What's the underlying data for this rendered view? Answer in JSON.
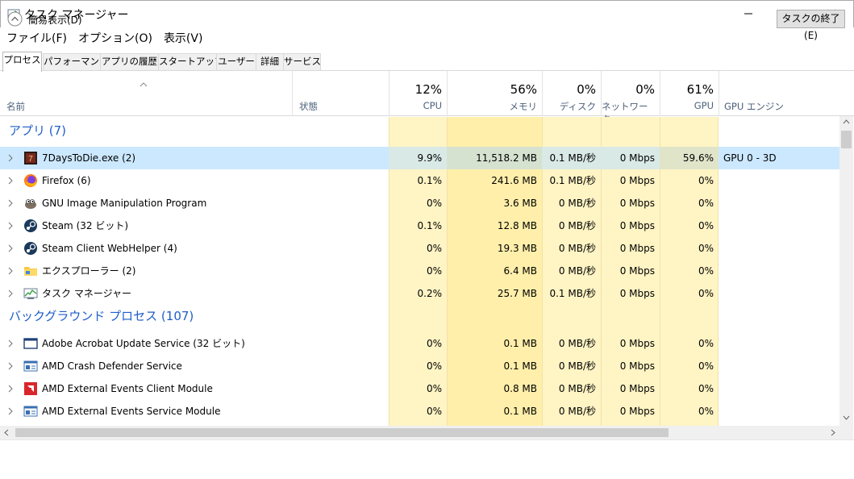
{
  "window": {
    "title": "タスク マネージャー",
    "icon": "task-manager-icon",
    "controls": [
      "minimize-icon",
      "maximize-icon",
      "close-icon"
    ]
  },
  "menu": [
    "ファイル(F)",
    "オプション(O)",
    "表示(V)"
  ],
  "tabs": [
    "プロセス",
    "パフォーマンス",
    "アプリの履歴",
    "スタートアップ",
    "ユーザー",
    "詳細",
    "サービス"
  ],
  "active_tab": "プロセス",
  "columns": {
    "name": "名前",
    "status": "状態",
    "cpu": {
      "percent": "12%",
      "label": "CPU"
    },
    "memory": {
      "percent": "56%",
      "label": "メモリ"
    },
    "disk": {
      "percent": "0%",
      "label": "ディスク"
    },
    "network": {
      "percent": "0%",
      "label": "ネットワーク"
    },
    "gpu": {
      "percent": "61%",
      "label": "GPU"
    },
    "gpu_engine": "GPU エンジン",
    "sort_indicator": "chevron-up-icon"
  },
  "groups": [
    {
      "title": "アプリ (7)",
      "items": [
        {
          "name": "7DaysToDie.exe (2)",
          "icon": "7days-icon",
          "cpu": "9.9%",
          "memory": "11,518.2 MB",
          "disk": "0.1 MB/秒",
          "network": "0 Mbps",
          "gpu": "59.6%",
          "gpu_engine": "GPU 0 - 3D",
          "selected": true
        },
        {
          "name": "Firefox (6)",
          "icon": "firefox-icon",
          "cpu": "0.1%",
          "memory": "241.6 MB",
          "disk": "0.1 MB/秒",
          "network": "0 Mbps",
          "gpu": "0%",
          "gpu_engine": ""
        },
        {
          "name": "GNU Image Manipulation Program",
          "icon": "gimp-icon",
          "cpu": "0%",
          "memory": "3.6 MB",
          "disk": "0 MB/秒",
          "network": "0 Mbps",
          "gpu": "0%",
          "gpu_engine": ""
        },
        {
          "name": "Steam (32 ビット)",
          "icon": "steam-icon",
          "cpu": "0.1%",
          "memory": "12.8 MB",
          "disk": "0 MB/秒",
          "network": "0 Mbps",
          "gpu": "0%",
          "gpu_engine": ""
        },
        {
          "name": "Steam Client WebHelper (4)",
          "icon": "steam-icon",
          "cpu": "0%",
          "memory": "19.3 MB",
          "disk": "0 MB/秒",
          "network": "0 Mbps",
          "gpu": "0%",
          "gpu_engine": ""
        },
        {
          "name": "エクスプローラー (2)",
          "icon": "folder-icon",
          "cpu": "0%",
          "memory": "6.4 MB",
          "disk": "0 MB/秒",
          "network": "0 Mbps",
          "gpu": "0%",
          "gpu_engine": ""
        },
        {
          "name": "タスク マネージャー",
          "icon": "task-manager-icon",
          "cpu": "0.2%",
          "memory": "25.7 MB",
          "disk": "0.1 MB/秒",
          "network": "0 Mbps",
          "gpu": "0%",
          "gpu_engine": ""
        }
      ]
    },
    {
      "title": "バックグラウンド プロセス (107)",
      "items": [
        {
          "name": "Adobe Acrobat Update Service (32 ビット)",
          "icon": "window-icon",
          "cpu": "0%",
          "memory": "0.1 MB",
          "disk": "0 MB/秒",
          "network": "0 Mbps",
          "gpu": "0%",
          "gpu_engine": ""
        },
        {
          "name": "AMD Crash Defender Service",
          "icon": "service-icon",
          "cpu": "0%",
          "memory": "0.1 MB",
          "disk": "0 MB/秒",
          "network": "0 Mbps",
          "gpu": "0%",
          "gpu_engine": ""
        },
        {
          "name": "AMD External Events Client Module",
          "icon": "amd-icon",
          "cpu": "0%",
          "memory": "0.8 MB",
          "disk": "0 MB/秒",
          "network": "0 Mbps",
          "gpu": "0%",
          "gpu_engine": ""
        },
        {
          "name": "AMD External Events Service Module",
          "icon": "service-icon",
          "cpu": "0%",
          "memory": "0.1 MB",
          "disk": "0 MB/秒",
          "network": "0 Mbps",
          "gpu": "0%",
          "gpu_engine": ""
        }
      ]
    }
  ],
  "footer": {
    "fewer_details": "簡易表示(D)",
    "end_task": "タスクの終了(E)"
  },
  "colors": {
    "heat_light": "#fff4c4",
    "heat_memory": "#ffefaa",
    "selected_row": "#cce8ff",
    "group_title": "#1d5ec9",
    "header_label": "#4c607a"
  }
}
